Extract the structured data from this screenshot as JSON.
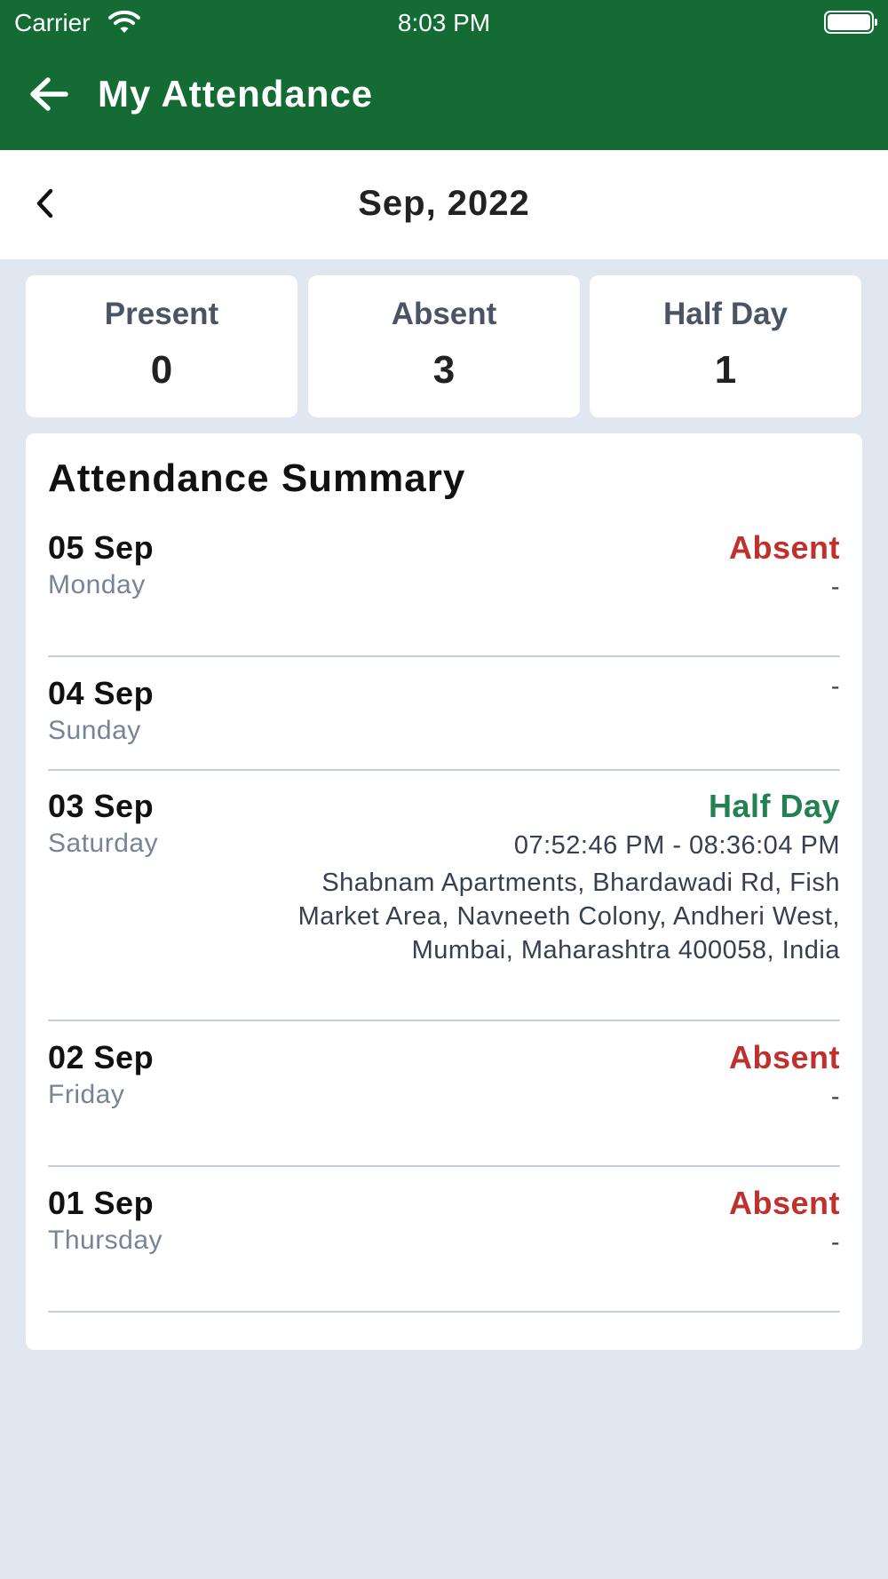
{
  "status_bar": {
    "carrier": "Carrier",
    "time": "8:03 PM"
  },
  "header": {
    "title": "My Attendance"
  },
  "month_nav": {
    "label": "Sep, 2022"
  },
  "stats": [
    {
      "label": "Present",
      "value": "0"
    },
    {
      "label": "Absent",
      "value": "3"
    },
    {
      "label": "Half Day",
      "value": "1"
    }
  ],
  "summary": {
    "title": "Attendance Summary",
    "rows": [
      {
        "date": "05 Sep",
        "day": "Monday",
        "status": "Absent",
        "detail": "-"
      },
      {
        "date": "04 Sep",
        "day": "Sunday",
        "status": "",
        "detail": "-"
      },
      {
        "date": "03 Sep",
        "day": "Saturday",
        "status": "Half Day",
        "time": "07:52:46 PM - 08:36:04 PM",
        "address": "Shabnam Apartments, Bhardawadi Rd, Fish Market Area, Navneeth Colony, Andheri West, Mumbai, Maharashtra 400058, India"
      },
      {
        "date": "02 Sep",
        "day": "Friday",
        "status": "Absent",
        "detail": "-"
      },
      {
        "date": "01 Sep",
        "day": "Thursday",
        "status": "Absent",
        "detail": "-"
      }
    ]
  },
  "colors": {
    "header_green": "#146c34",
    "absent_red": "#c0302c",
    "half_day_green": "#238050",
    "background": "#e1e7f0"
  },
  "icons": {
    "back": "arrow-left-icon",
    "prev_month": "chevron-left-icon",
    "wifi": "wifi-icon",
    "battery": "battery-icon"
  }
}
